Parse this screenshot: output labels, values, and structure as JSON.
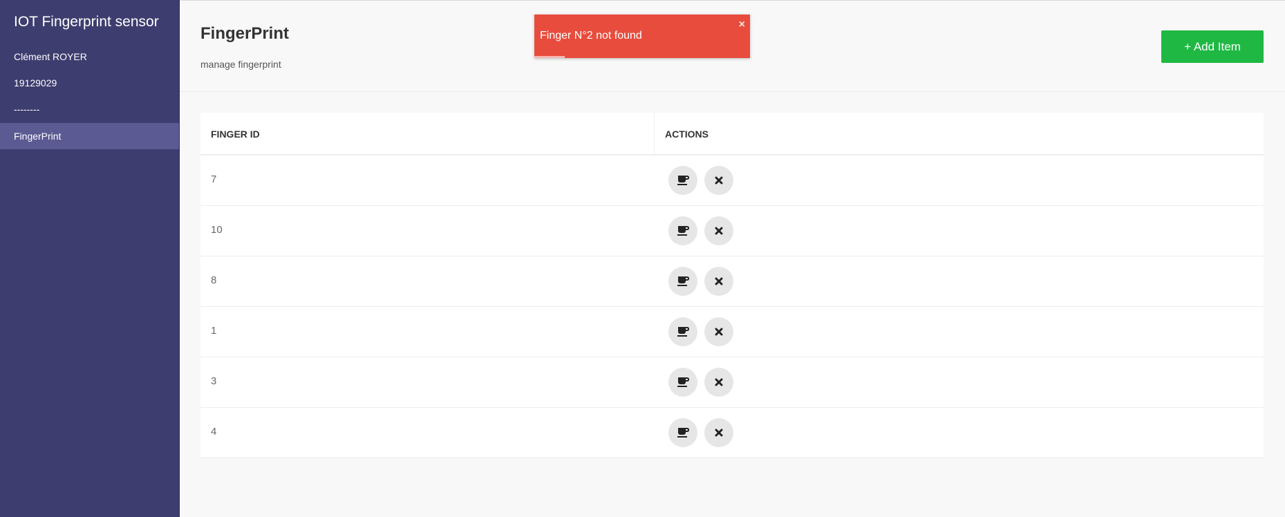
{
  "sidebar": {
    "title": "IOT Fingerprint sensor",
    "user": "Clément ROYER",
    "id": "19129029",
    "separator": "--------",
    "items": [
      {
        "label": "FingerPrint",
        "active": true
      }
    ]
  },
  "header": {
    "title": "FingerPrint",
    "subtitle": "manage fingerprint",
    "add_button_label": "+ Add Item"
  },
  "toast": {
    "message": "Finger N°2 not found",
    "close_symbol": "×",
    "color": "#e84c3d",
    "progress": 0.14
  },
  "table": {
    "columns": [
      "FINGER ID",
      "ACTIONS"
    ],
    "rows": [
      {
        "finger_id": "7"
      },
      {
        "finger_id": "10"
      },
      {
        "finger_id": "8"
      },
      {
        "finger_id": "1"
      },
      {
        "finger_id": "3"
      },
      {
        "finger_id": "4"
      }
    ],
    "row_actions": [
      {
        "icon": "coffee-icon"
      },
      {
        "icon": "close-icon"
      }
    ]
  },
  "colors": {
    "sidebar_bg": "#3e3d6f",
    "sidebar_active": "#5b5a92",
    "add_button": "#1fb843",
    "toast": "#e84c3d"
  }
}
